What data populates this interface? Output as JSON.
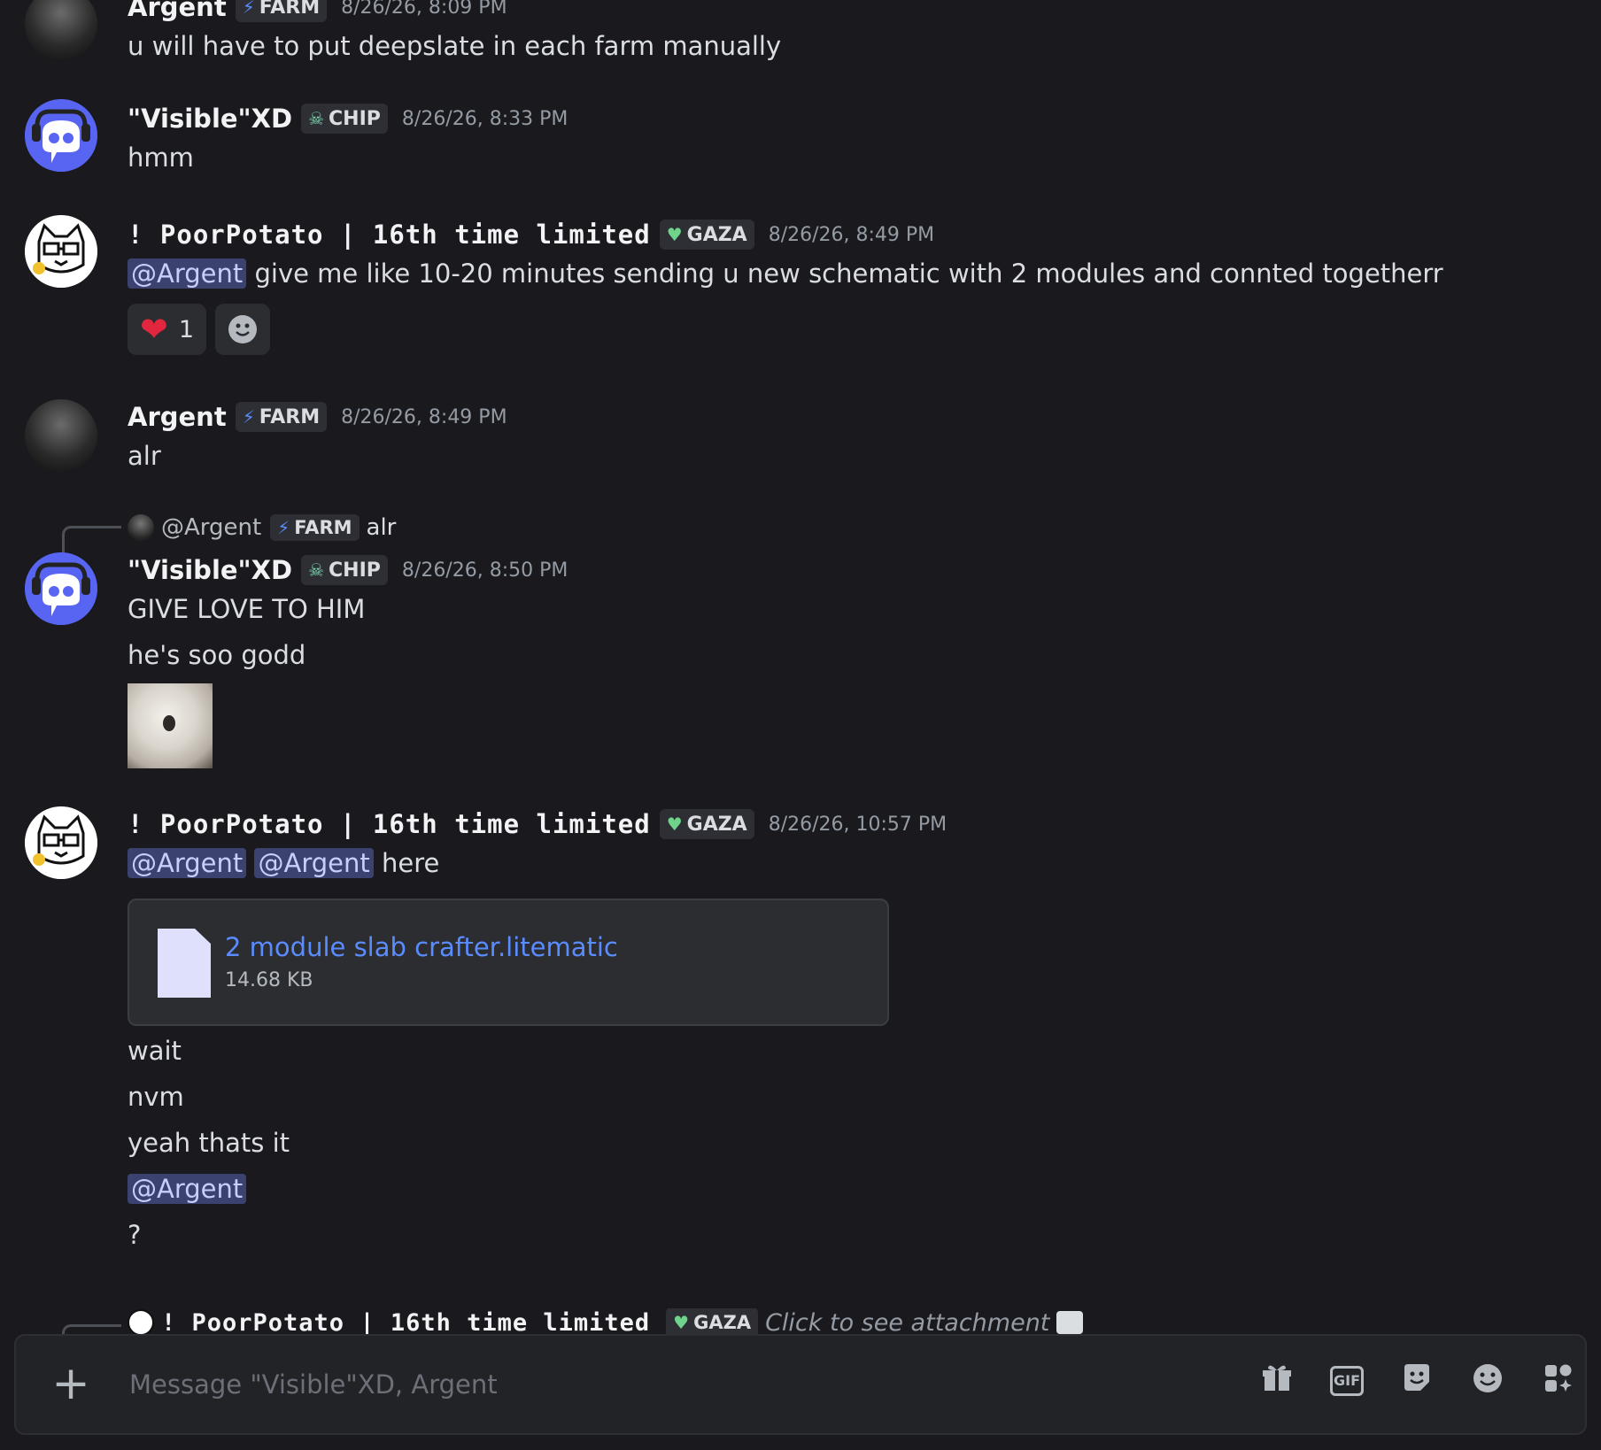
{
  "composer": {
    "placeholder": "Message \"Visible\"XD, Argent",
    "plus_icon": "plus-icon",
    "tools": [
      "gift-icon",
      "gif-icon",
      "sticker-icon",
      "emoji-icon",
      "apps-icon"
    ],
    "gif_label": "GIF"
  },
  "messages": [
    {
      "author": "Argent",
      "tag": "FARM",
      "tag_icon": "bolt-icon",
      "timestamp": "8/26/26, 8:09 PM",
      "lines": [
        "u will have to put  deepslate in each farm manually"
      ]
    },
    {
      "author": "\"Visible\"XD",
      "tag": "CHIP",
      "tag_icon": "skull-icon",
      "timestamp": "8/26/26, 8:33 PM",
      "lines": [
        "hmm"
      ]
    },
    {
      "author": "! PoorPotato | 16th time limited",
      "tag": "GAZA",
      "tag_icon": "green-heart-icon",
      "timestamp": "8/26/26, 8:49 PM",
      "mention": "@Argent",
      "text": "give me like 10-20 minutes sending u new schematic with 2 modules and connted togetherr",
      "reaction_count": "1"
    },
    {
      "author": "Argent",
      "tag": "FARM",
      "tag_icon": "bolt-icon",
      "timestamp": "8/26/26, 8:49 PM",
      "lines": [
        "alr"
      ]
    },
    {
      "reply": {
        "author": "@Argent",
        "tag": "FARM",
        "text": "alr"
      },
      "author": "\"Visible\"XD",
      "tag": "CHIP",
      "tag_icon": "skull-icon",
      "timestamp": "8/26/26, 8:50 PM",
      "lines": [
        "GIVE LOVE TO HIM",
        "he's soo godd"
      ]
    },
    {
      "author": "! PoorPotato | 16th time limited",
      "tag": "GAZA",
      "tag_icon": "green-heart-icon",
      "timestamp": "8/26/26, 10:57 PM",
      "mentions": [
        "@Argent",
        "@Argent"
      ],
      "text": "here",
      "attachment": {
        "name": "2 module slab crafter.litematic",
        "size": "14.68 KB"
      },
      "lines_after": [
        "wait",
        "nvm",
        "yeah thats it"
      ],
      "mention_line": "@Argent",
      "last_line": "?"
    }
  ],
  "cut_reply": {
    "author": "! PoorPotato | 16th time limited",
    "tag": "GAZA",
    "text": "Click to see attachment"
  }
}
